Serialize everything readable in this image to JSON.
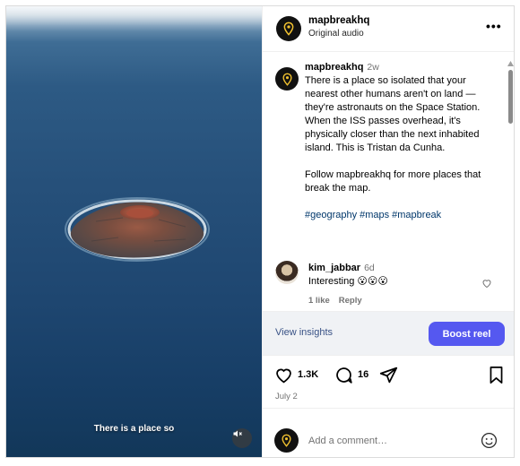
{
  "video": {
    "caption": "There is a place so",
    "mute_icon": "speaker-muted-icon"
  },
  "header": {
    "username": "mapbreakhq",
    "subtitle": "Original audio",
    "more": "•••"
  },
  "post": {
    "username": "mapbreakhq",
    "time": "2w",
    "caption_p1": "There is a place so isolated that your nearest other humans aren't on land — they're astronauts on the Space Station. When the ISS passes overhead, it's physically closer than the next inhabited island. This is Tristan da Cunha.",
    "caption_p2": "Follow mapbreakhq for more places that break the map.",
    "hashtags": [
      "#geography",
      "#maps",
      "#mapbreak"
    ]
  },
  "comment": {
    "username": "kim_jabbar",
    "time": "6d",
    "text": "Interesting 😮😮😮",
    "likes": "1 like",
    "reply": "Reply"
  },
  "insights": {
    "view_label": "View insights",
    "boost_label": "Boost reel"
  },
  "actions": {
    "likes": "1.3K",
    "comments": "16",
    "date": "July 2"
  },
  "add_comment": {
    "placeholder": "Add a comment…"
  },
  "colors": {
    "boost": "#5558f0",
    "link": "#00376b"
  }
}
